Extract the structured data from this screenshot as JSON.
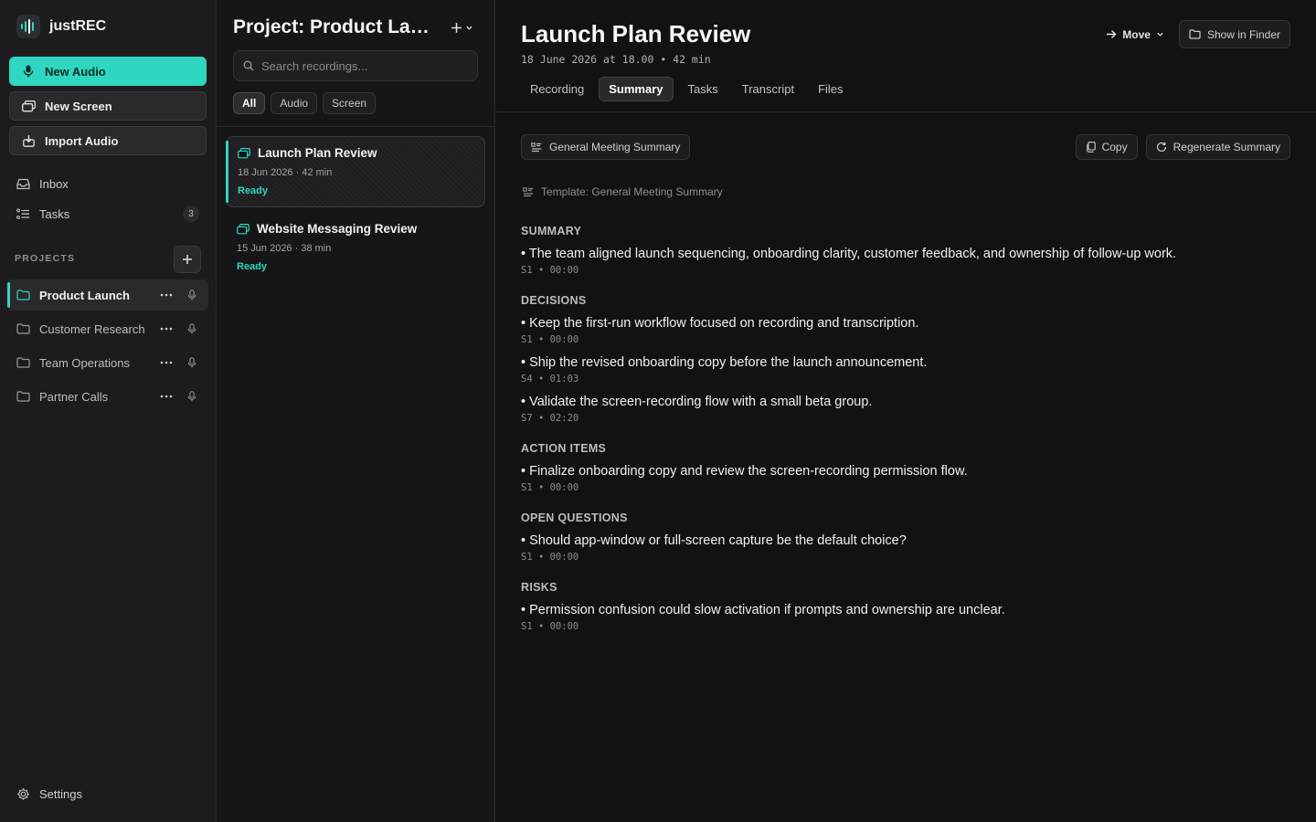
{
  "app": {
    "name": "justREC"
  },
  "sidebar": {
    "new_audio": "New Audio",
    "new_screen": "New Screen",
    "import_audio": "Import Audio",
    "inbox": "Inbox",
    "tasks": "Tasks",
    "tasks_count": "3",
    "projects_heading": "PROJECTS",
    "projects": [
      {
        "label": "Product Launch",
        "active": true
      },
      {
        "label": "Customer Research",
        "active": false
      },
      {
        "label": "Team Operations",
        "active": false
      },
      {
        "label": "Partner Calls",
        "active": false
      }
    ],
    "settings": "Settings"
  },
  "list": {
    "title": "Project: Product Launch",
    "search_placeholder": "Search recordings...",
    "filters": [
      {
        "label": "All",
        "active": true
      },
      {
        "label": "Audio",
        "active": false
      },
      {
        "label": "Screen",
        "active": false
      }
    ],
    "recordings": [
      {
        "title": "Launch Plan Review",
        "meta": "18 Jun 2026 · 42 min",
        "status": "Ready",
        "active": true
      },
      {
        "title": "Website Messaging Review",
        "meta": "15 Jun 2026 · 38 min",
        "status": "Ready",
        "active": false
      }
    ]
  },
  "main": {
    "title": "Launch Plan Review",
    "subtitle": "18 June 2026 at 18.00 • 42 min",
    "move_label": "Move",
    "finder_label": "Show in Finder",
    "tabs": [
      {
        "label": "Recording",
        "active": false
      },
      {
        "label": "Summary",
        "active": true
      },
      {
        "label": "Tasks",
        "active": false
      },
      {
        "label": "Transcript",
        "active": false
      },
      {
        "label": "Files",
        "active": false
      }
    ],
    "template_button": "General Meeting Summary",
    "copy_label": "Copy",
    "regenerate_label": "Regenerate Summary",
    "template_line": "Template: General Meeting Summary",
    "sections": [
      {
        "heading": "SUMMARY",
        "items": [
          {
            "text": "• The team aligned launch sequencing, onboarding clarity, customer feedback, and ownership of follow-up work.",
            "ref": "S1 • 00:00"
          }
        ]
      },
      {
        "heading": "DECISIONS",
        "items": [
          {
            "text": "• Keep the first-run workflow focused on recording and transcription.",
            "ref": "S1 • 00:00"
          },
          {
            "text": "• Ship the revised onboarding copy before the launch announcement.",
            "ref": "S4 • 01:03"
          },
          {
            "text": "• Validate the screen-recording flow with a small beta group.",
            "ref": "S7 • 02:20"
          }
        ]
      },
      {
        "heading": "ACTION ITEMS",
        "items": [
          {
            "text": "• Finalize onboarding copy and review the screen-recording permission flow.",
            "ref": "S1 • 00:00"
          }
        ]
      },
      {
        "heading": "OPEN QUESTIONS",
        "items": [
          {
            "text": "• Should app-window or full-screen capture be the default choice?",
            "ref": "S1 • 00:00"
          }
        ]
      },
      {
        "heading": "RISKS",
        "items": [
          {
            "text": "• Permission confusion could slow activation if prompts and ownership are unclear.",
            "ref": "S1 • 00:00"
          }
        ]
      }
    ]
  },
  "colors": {
    "accent": "#2fd6c0",
    "background": "#121212",
    "sidebar": "#1c1c1e"
  }
}
